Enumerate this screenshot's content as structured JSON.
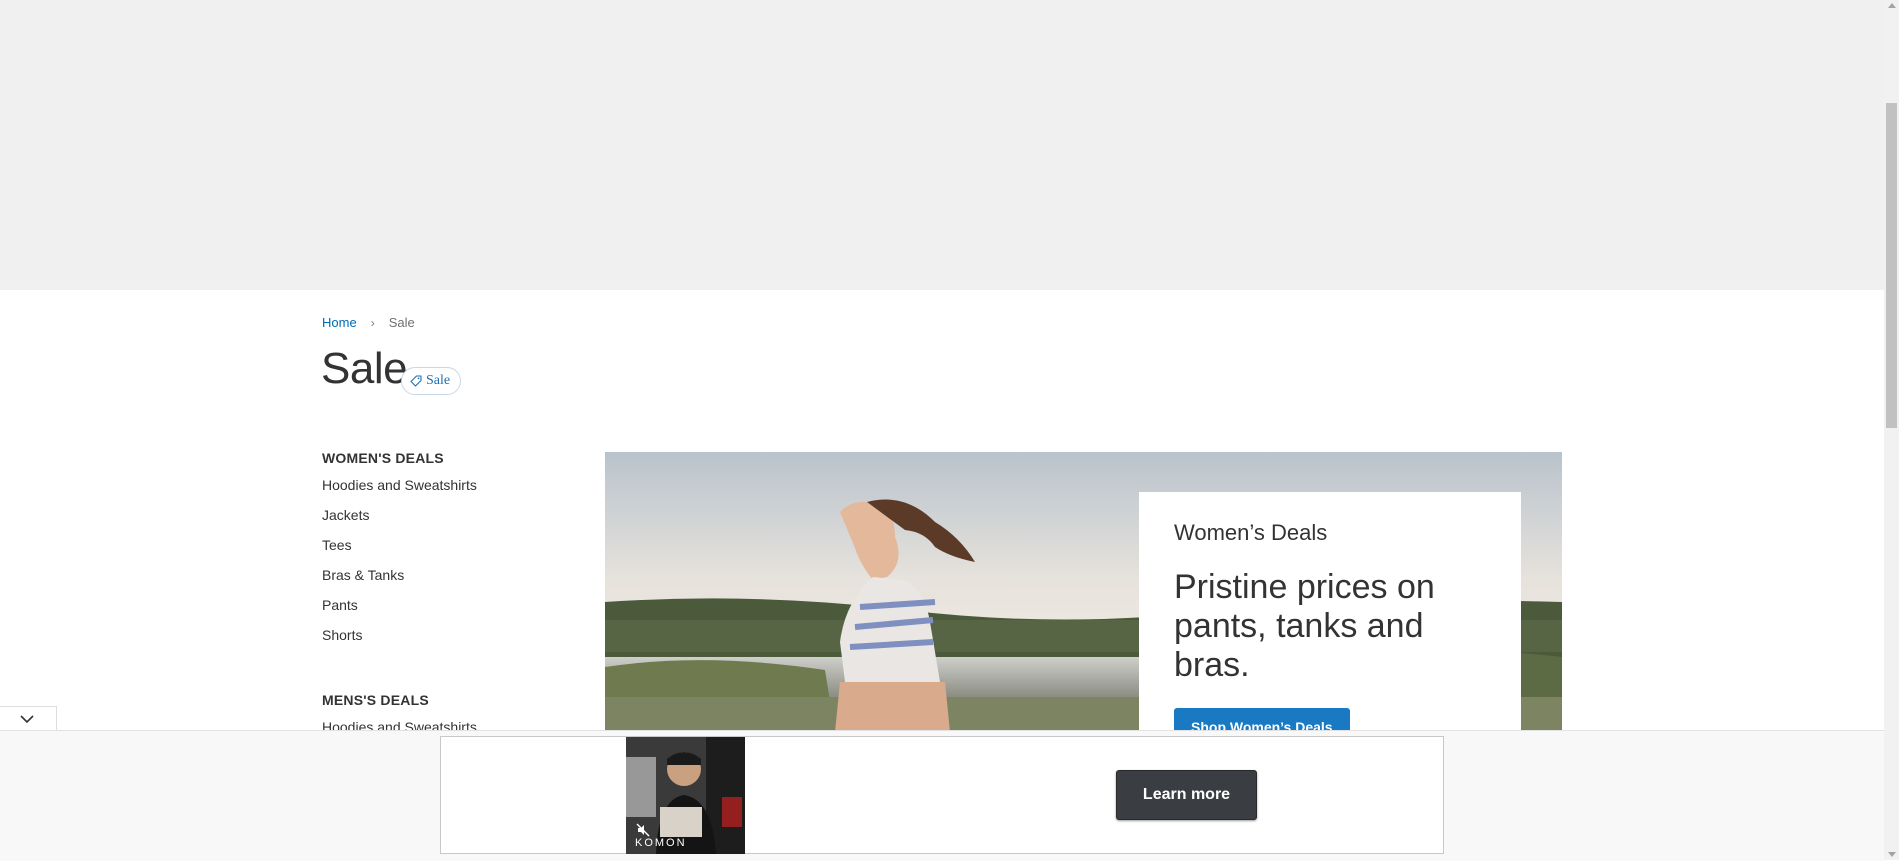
{
  "breadcrumb": {
    "home": "Home",
    "separator": "›",
    "current": "Sale"
  },
  "page": {
    "title": "Sale",
    "badge_label": "Sale",
    "badge_icon": "tag-icon"
  },
  "sidebar": {
    "womens": {
      "title": "WOMEN'S DEALS",
      "items": [
        "Hoodies and Sweatshirts",
        "Jackets",
        "Tees",
        "Bras & Tanks",
        "Pants",
        "Shorts"
      ]
    },
    "mens": {
      "title": "MENS'S DEALS",
      "items": [
        "Hoodies and Sweatshirts"
      ]
    }
  },
  "promo": {
    "kicker": "Women’s Deals",
    "headline": "Pristine prices on pants, tanks and bras.",
    "button": "Shop Women’s Deals"
  },
  "ad": {
    "cta": "Learn more",
    "brand": "KOMON",
    "collapse_icon": "chevron-down-icon",
    "mute_icon": "mute-icon"
  },
  "colors": {
    "link": "#006bb4",
    "button": "#1979c3",
    "top_band": "#f0f0f0",
    "ad_button": "#3a3d42"
  }
}
